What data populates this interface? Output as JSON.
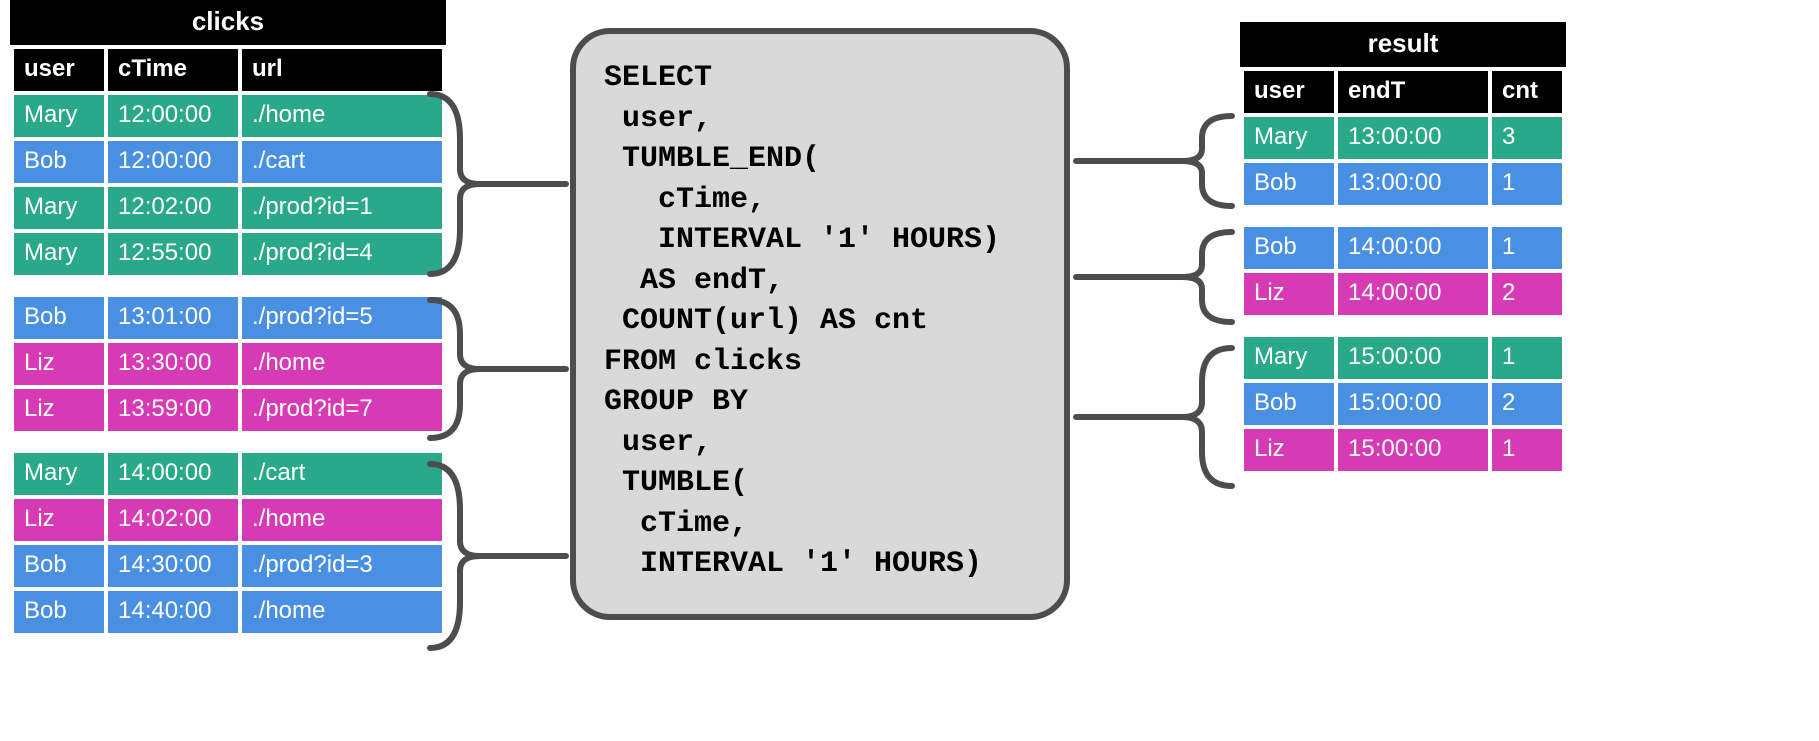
{
  "colors": {
    "Mary": "#2aa98a",
    "Bob": "#4a90e2",
    "Liz": "#d63bb5"
  },
  "clicks": {
    "title": "clicks",
    "headers": [
      "user",
      "cTime",
      "url"
    ],
    "groups": [
      [
        {
          "user": "Mary",
          "cTime": "12:00:00",
          "url": "./home"
        },
        {
          "user": "Bob",
          "cTime": "12:00:00",
          "url": "./cart"
        },
        {
          "user": "Mary",
          "cTime": "12:02:00",
          "url": "./prod?id=1"
        },
        {
          "user": "Mary",
          "cTime": "12:55:00",
          "url": "./prod?id=4"
        }
      ],
      [
        {
          "user": "Bob",
          "cTime": "13:01:00",
          "url": "./prod?id=5"
        },
        {
          "user": "Liz",
          "cTime": "13:30:00",
          "url": "./home"
        },
        {
          "user": "Liz",
          "cTime": "13:59:00",
          "url": "./prod?id=7"
        }
      ],
      [
        {
          "user": "Mary",
          "cTime": "14:00:00",
          "url": "./cart"
        },
        {
          "user": "Liz",
          "cTime": "14:02:00",
          "url": "./home"
        },
        {
          "user": "Bob",
          "cTime": "14:30:00",
          "url": "./prod?id=3"
        },
        {
          "user": "Bob",
          "cTime": "14:40:00",
          "url": "./home"
        }
      ]
    ]
  },
  "sql": "SELECT\n user,\n TUMBLE_END(\n   cTime,\n   INTERVAL '1' HOURS)\n  AS endT,\n COUNT(url) AS cnt\nFROM clicks\nGROUP BY\n user,\n TUMBLE(\n  cTime,\n  INTERVAL '1' HOURS)",
  "result": {
    "title": "result",
    "headers": [
      "user",
      "endT",
      "cnt"
    ],
    "groups": [
      [
        {
          "user": "Mary",
          "endT": "13:00:00",
          "cnt": "3"
        },
        {
          "user": "Bob",
          "endT": "13:00:00",
          "cnt": "1"
        }
      ],
      [
        {
          "user": "Bob",
          "endT": "14:00:00",
          "cnt": "1"
        },
        {
          "user": "Liz",
          "endT": "14:00:00",
          "cnt": "2"
        }
      ],
      [
        {
          "user": "Mary",
          "endT": "15:00:00",
          "cnt": "1"
        },
        {
          "user": "Bob",
          "endT": "15:00:00",
          "cnt": "2"
        },
        {
          "user": "Liz",
          "endT": "15:00:00",
          "cnt": "1"
        }
      ]
    ]
  }
}
